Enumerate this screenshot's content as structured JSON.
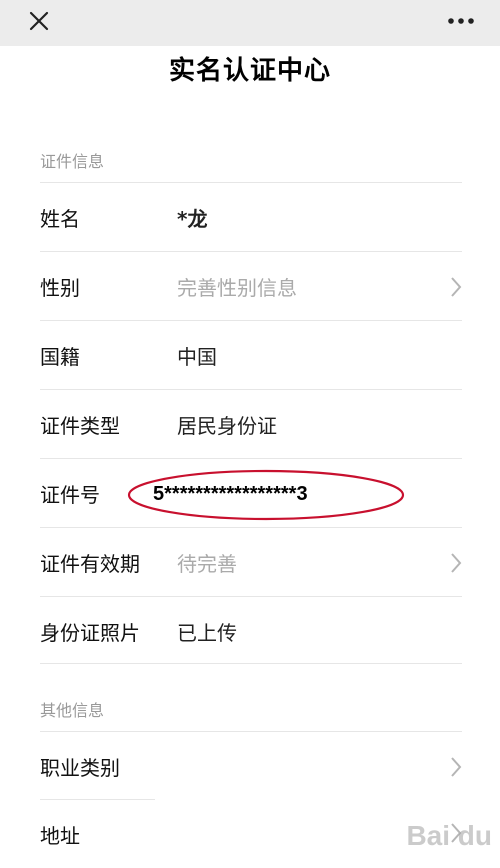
{
  "topbar": {
    "close_icon": "close-icon",
    "more_icon": "more-icon"
  },
  "page": {
    "title": "实名认证中心"
  },
  "sections": {
    "id_info_header": "证件信息",
    "other_info_header": "其他信息"
  },
  "rows": {
    "name": {
      "label": "姓名",
      "value": "*龙"
    },
    "gender": {
      "label": "性别",
      "value": "完善性别信息"
    },
    "nationality": {
      "label": "国籍",
      "value": "中国"
    },
    "id_type": {
      "label": "证件类型",
      "value": "居民身份证"
    },
    "id_number": {
      "label": "证件号",
      "value": "5*****************3"
    },
    "validity": {
      "label": "证件有效期",
      "value": "待完善"
    },
    "id_photo": {
      "label": "身份证照片",
      "value": "已上传"
    },
    "occupation": {
      "label": "职业类别"
    },
    "address": {
      "label": "地址"
    }
  },
  "watermark": {
    "text": "Bai du"
  },
  "colors": {
    "topbar_bg": "#ececec",
    "placeholder": "#aaaaaa",
    "section_header": "#999999",
    "highlight_ellipse": "#c8102e"
  }
}
